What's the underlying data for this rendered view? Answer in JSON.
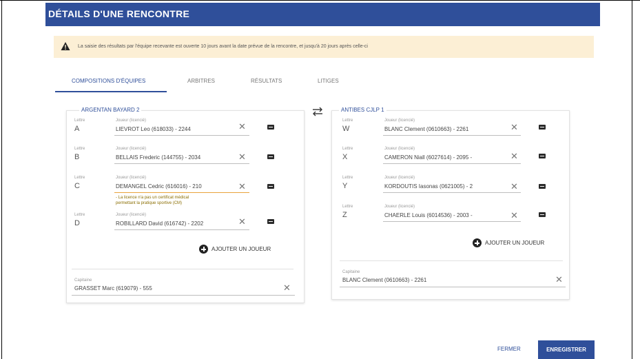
{
  "dialog": {
    "title": "DÉTAILS D'UNE RENCONTRE",
    "warning": "La saisie des résultats par l'équipe recevante est ouverte 10 jours avant la date prévue de la rencontre, et jusqu'à 20 jours après celle-ci"
  },
  "tabs": [
    {
      "label": "COMPOSITIONS D'ÉQUIPES",
      "active": true
    },
    {
      "label": "ARBITRES",
      "active": false
    },
    {
      "label": "RÉSULTATS",
      "active": false
    },
    {
      "label": "LITIGES",
      "active": false
    }
  ],
  "labels": {
    "letter": "Lettre",
    "player": "Joueur (licencié)",
    "captain": "Capitaine",
    "add_player": "AJOUTER UN JOUEUR"
  },
  "teams": [
    {
      "name": "ARGENTAN BAYARD 2",
      "players": [
        {
          "letter": "A",
          "value": "LIEVROT Leo (618033) - 2244"
        },
        {
          "letter": "B",
          "value": "BELLAIS Frederic (144755) - 2034"
        },
        {
          "letter": "C",
          "value": "DEMANGEL Cedric (616016) - 210",
          "error": [
            "- La licence n'a pas un certificat médical",
            "permettant la pratique sportive (CM)"
          ]
        },
        {
          "letter": "D",
          "value": "ROBILLARD David (616742) - 2202"
        }
      ],
      "captain": "GRASSET Marc (619079) - 555"
    },
    {
      "name": "ANTIBES CJLP 1",
      "players": [
        {
          "letter": "W",
          "value": "BLANC Clement (0610663) - 2261"
        },
        {
          "letter": "X",
          "value": "CAMERON Niall (6027614) - 2095 -"
        },
        {
          "letter": "Y",
          "value": "KORDOUTIS Iasonas (0621005) - 2"
        },
        {
          "letter": "Z",
          "value": "CHAERLE Louis (6014536) - 2003 -"
        }
      ],
      "captain": "BLANC Clement (0610663) - 2261"
    }
  ],
  "footer": {
    "close": "FERMER",
    "save": "ENREGISTRER"
  },
  "colors": {
    "primary": "#2f4f9a",
    "warning_bg": "#fcefd5",
    "error_line": "#e8a33a"
  },
  "icons": {
    "warning": "warning-triangle-icon",
    "swap": "swap-arrows-icon",
    "clear": "close-icon",
    "card": "id-card-icon",
    "add": "add-circle-icon"
  }
}
